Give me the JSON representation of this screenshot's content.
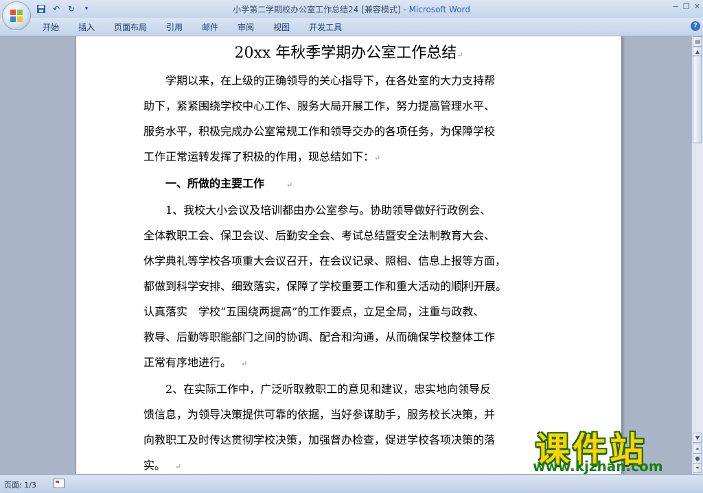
{
  "window": {
    "title": "小学第二学期校办公室工作总结24 [兼容模式] - ",
    "app_name": "Microsoft Word",
    "controls": [
      "−",
      "❐",
      "✕"
    ]
  },
  "quick_access": {
    "icons": [
      "save-icon",
      "undo-icon",
      "redo-icon",
      "customize-icon"
    ]
  },
  "ribbon": {
    "tabs": [
      "开始",
      "插入",
      "页面布局",
      "引用",
      "邮件",
      "审阅",
      "视图",
      "开发工具"
    ],
    "help": "?"
  },
  "document": {
    "title": "20xx 年秋季学期办公室工作总结",
    "lines": [
      "　　学期以来，在上级的正确领导的关心指导下，在各处室的大力支持帮",
      "助下，紧紧围绕学校中心工作、服务大局开展工作，努力提高管理水平、",
      "服务水平，积极完成办公室常规工作和领导交办的各项任务，为保障学校",
      "工作正常运转发挥了积极的作用，现总结如下：",
      "　　一、所做的主要工作　",
      "　　1、我校大小会议及培训都由办公室参与。协助领导做好行政例会、",
      "全体教职工会、保卫会议、后勤安全会、考试总结暨安全法制教育大会、",
      "休学典礼等学校各项重大会议召开，在会议记录、照相、信息上报等方面，",
      "都做到科学安排、细致落实，保障了学校重要工作和重大活动的顺",
      "认真落实　学校“五围绕两提高”的工作要点，立足全局，注重与政教、",
      "教导、后勤等职能部门之间的协调、配合和沟通，从而确保学校整体工作",
      "正常有序地进行。",
      "　　2、在实际工作中，广泛听取教职工的意见和建议，忠实地向领导反",
      "馈信息，为领导决策提供可靠的依据，当好参谋助手，服务校长决策，并",
      "向教职工及时传达贯彻学校决策，加强督办检查，促进学校各项决策的落",
      "实。"
    ],
    "line8_after_cursor": "利开展。",
    "paragraph_mark": "↵"
  },
  "status": {
    "page": "页面: 1/3"
  },
  "watermark": {
    "text": "课件站",
    "url": "www.kjzhan.com"
  }
}
